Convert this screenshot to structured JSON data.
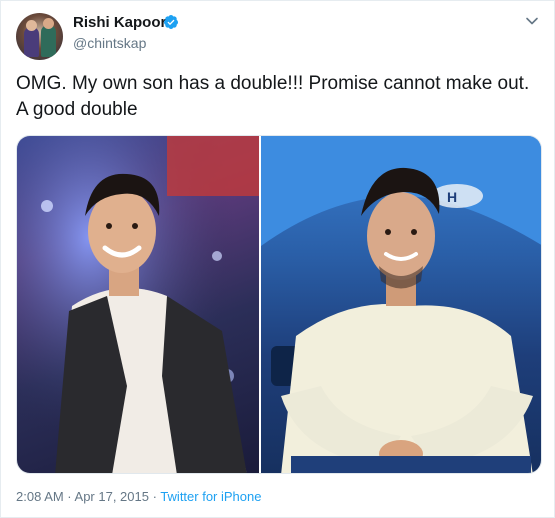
{
  "author": {
    "name": "Rishi Kapoor",
    "handle": "@chintskap"
  },
  "tweet": {
    "text": "OMG. My own son has a double!!! Promise cannot make out. A good double"
  },
  "media": [
    {
      "icon": "photo-left"
    },
    {
      "icon": "photo-right"
    }
  ],
  "meta": {
    "timestamp": "2:08 AM · Apr 17, 2015",
    "separator": " · ",
    "source": "Twitter for iPhone"
  },
  "colors": {
    "link": "#1da1f2",
    "secondary_text": "#657786",
    "primary_text": "#14171a"
  }
}
